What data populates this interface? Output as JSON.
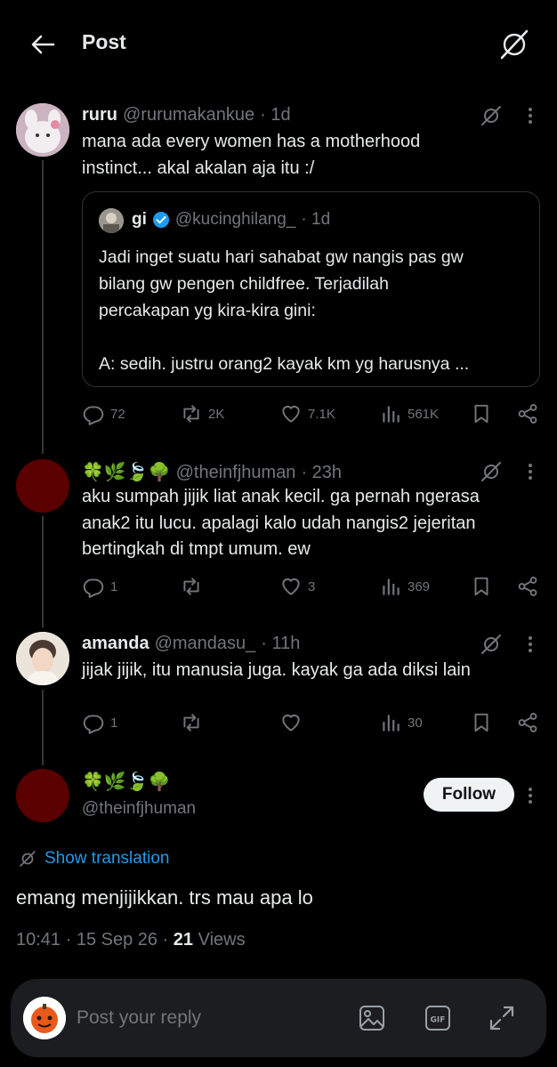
{
  "header": {
    "title": "Post"
  },
  "posts": [
    {
      "name": "ruru",
      "handle": "@rurumakankue",
      "time": "· 1d",
      "text_lines": [
        "mana ada every women has a motherhood",
        "instinct... akal akalan aja itu :/"
      ],
      "quote": {
        "name": "gi",
        "handle": "@kucinghilang_",
        "time": "· 1d",
        "text_lines": [
          "Jadi inget suatu hari sahabat gw nangis pas gw",
          "bilang gw pengen childfree. Terjadilah",
          "percakapan yg kira-kira gini:",
          "",
          "A: sedih. justru orang2 kayak km yg harusnya ..."
        ]
      },
      "stats": {
        "replies": "72",
        "reposts": "2K",
        "likes": "7.1K",
        "views": "561K"
      }
    },
    {
      "name": "🍀🌿🍃🌳",
      "handle": "@theinfjhuman",
      "time": "· 23h",
      "text_lines": [
        "aku sumpah jijik liat anak kecil. ga pernah ngerasa",
        "anak2 itu lucu. apalagi kalo udah nangis2 jejeritan",
        "bertingkah di tmpt umum. ew"
      ],
      "stats": {
        "replies": "1",
        "reposts": "",
        "likes": "3",
        "views": "369"
      }
    },
    {
      "name": "amanda",
      "handle": "@mandasu_",
      "time": "· 11h",
      "text_lines": [
        "jijak jijik, itu manusia juga. kayak ga ada diksi lain"
      ],
      "stats": {
        "replies": "1",
        "reposts": "",
        "likes": "",
        "views": "30"
      }
    }
  ],
  "focus_post": {
    "name": "🍀🌿🍃🌳",
    "handle": "@theinfjhuman",
    "follow_label": "Follow",
    "show_translation": "Show translation",
    "text": "emang menjijikkan. trs mau apa lo",
    "meta_time": "10:41 · 15 Sep 26 · ",
    "views_count": "21",
    "views_label": " Views"
  },
  "reply_bar": {
    "placeholder": "Post your reply"
  },
  "colors": {
    "accent": "#1d9bf0",
    "verified": "#1d9bf0",
    "muted": "#71767b",
    "background": "#000000"
  }
}
